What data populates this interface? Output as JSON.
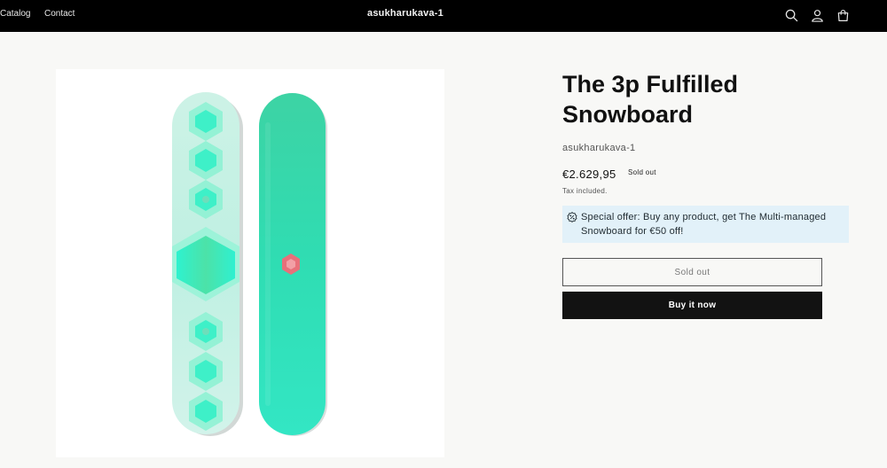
{
  "header": {
    "nav": [
      {
        "label": "Catalog"
      },
      {
        "label": "Contact"
      }
    ],
    "brand": "asukharukava-1",
    "icons": [
      "search-icon",
      "account-icon",
      "cart-icon"
    ]
  },
  "product": {
    "title": "The 3p Fulfilled Snowboard",
    "vendor": "asukharukava-1",
    "price": "€2.629,95",
    "badge": "Sold out",
    "tax_note": "Tax included.",
    "offer": {
      "icon": "discount-icon",
      "text": "Special offer: Buy any product, get The Multi-managed Snowboard for €50 off!"
    },
    "sold_out_button": "Sold out",
    "buy_button": "Buy it now"
  },
  "colors": {
    "header_bg": "#000000",
    "page_bg": "#f8f8f6",
    "offer_bg": "#e2f1f9",
    "button_dark": "#121212",
    "board_mint": "#c9f3e6",
    "board_teal": "#2ee0b8"
  }
}
